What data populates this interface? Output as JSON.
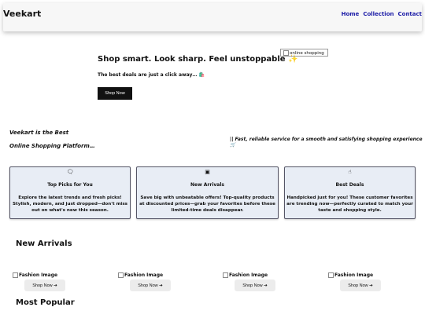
{
  "header": {
    "brand": "Veekart",
    "links": [
      "Home",
      "Collection",
      "Contact"
    ]
  },
  "hero": {
    "title": "Shop smart. Look sharp. Feel unstoppable ✨",
    "subtitle": "The best deals are just a click away… 🛍️",
    "button": "Shop Now",
    "image_alt": "online shopping"
  },
  "intro": {
    "line1": "Veekart is the Best",
    "line2": "Online Shopping Platform…",
    "tagline": "|| Fast, reliable service for a smooth and satisfying shopping experience 🛒"
  },
  "features": [
    {
      "icon": "chat-icon",
      "glyph": "🗨",
      "title": "Top Picks for You",
      "text": "Explore the latest trends and fresh picks! Stylish, modern, and just dropped—don't miss out on what's new this season."
    },
    {
      "icon": "arrivals-icon",
      "glyph": "▣",
      "title": "New Arrivals",
      "text": "Save big with unbeatable offers! Top-quality products at discounted prices—grab your favorites before these limited-time deals disappear."
    },
    {
      "icon": "hand-pointer-icon",
      "glyph": "☝",
      "title": "Best Deals",
      "text": "Handpicked just for you! These customer favorites are trending now—perfectly curated to match your taste and shopping style."
    }
  ],
  "new_arrivals": {
    "title": "New Arrivals",
    "products": [
      {
        "image_alt": "Fashion Image",
        "button": "Shop Now ➔"
      },
      {
        "image_alt": "Fashion Image",
        "button": "Shop Now ➔"
      },
      {
        "image_alt": "Fashion Image",
        "button": "Shop Now ➔"
      },
      {
        "image_alt": "Fashion Image",
        "button": "Shop Now ➔"
      }
    ]
  },
  "most_popular": {
    "title": "Most Popular"
  }
}
